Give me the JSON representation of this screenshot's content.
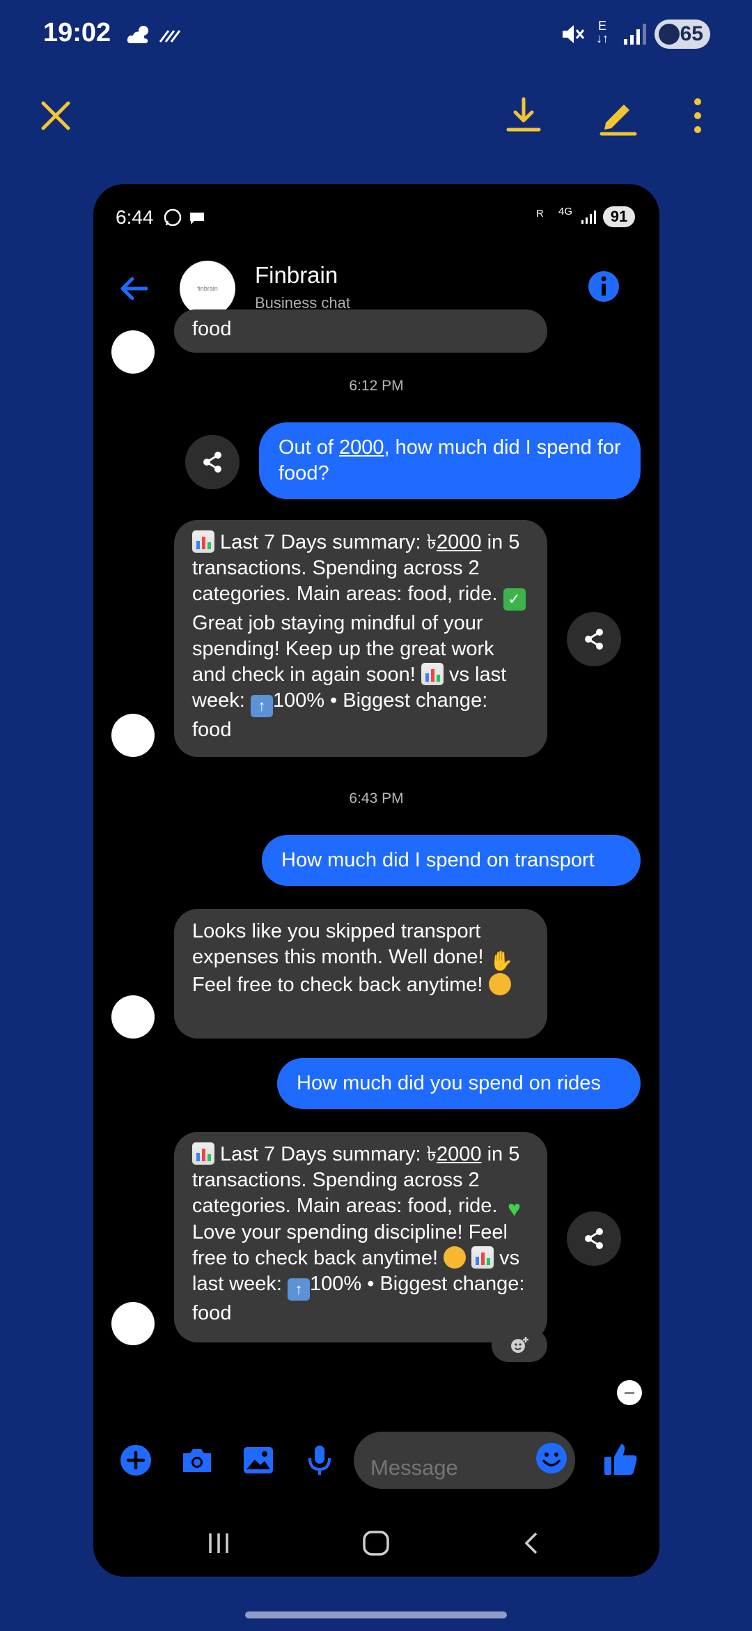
{
  "outer_status": {
    "time": "19:02",
    "net_label": "E",
    "battery": "65",
    "battery_level_percent": 65,
    "icons": [
      "weather-cloud-sun-icon",
      "data-saver-icon",
      "mute-icon",
      "signal-icon",
      "battery-icon"
    ]
  },
  "viewer_toolbar": {
    "accent_color": "#f3c531",
    "icons": [
      "close-icon",
      "download-icon",
      "edit-icon",
      "more-vert-icon"
    ]
  },
  "phone": {
    "status": {
      "time": "6:44",
      "r_label": "R",
      "net_label": "4G",
      "battery": "91"
    },
    "header": {
      "avatar_text": "finbrain",
      "name": "Finbrain",
      "subtitle": "Business chat"
    },
    "chat": {
      "partial_bubble_text": "food",
      "timestamp_1": "6:12 PM",
      "msg_out_1": {
        "pre": "Out of ",
        "num": "2000",
        "post": ", how much did I spend for food?"
      },
      "msg_in_1": {
        "t1": " Last 7 Days summary: ৳",
        "num": "2000",
        "t2": " in 5 transactions. Spending across 2 categories. Main areas: food, ride. ",
        "t3": " Great job staying mindful of your spending! Keep up the great work and check in again soon! ",
        "t4": " vs last week: ",
        "t5": "100% • Biggest change: food"
      },
      "timestamp_2": "6:43 PM",
      "msg_out_2": "How much did I spend on transport",
      "msg_in_2": {
        "t1": "Looks like you skipped transport expenses this month. Well done! ",
        "t2": " Feel free to check back anytime! "
      },
      "msg_out_3": "How much did you spend on rides",
      "msg_in_3": {
        "t1": " Last 7 Days summary: ৳",
        "num": "2000",
        "t2": " in 5 transactions. Spending across 2 categories. Main areas: food, ride. ",
        "t3": " Love your spending discipline! Feel free to check back anytime! ",
        "t4": " ",
        "t5": " vs last week: ",
        "t6": "100% • Biggest change: food"
      }
    },
    "composer": {
      "placeholder": "Message"
    },
    "colors": {
      "accent_blue": "#1f6bff",
      "bubble_incoming": "#3a3a3a"
    }
  }
}
